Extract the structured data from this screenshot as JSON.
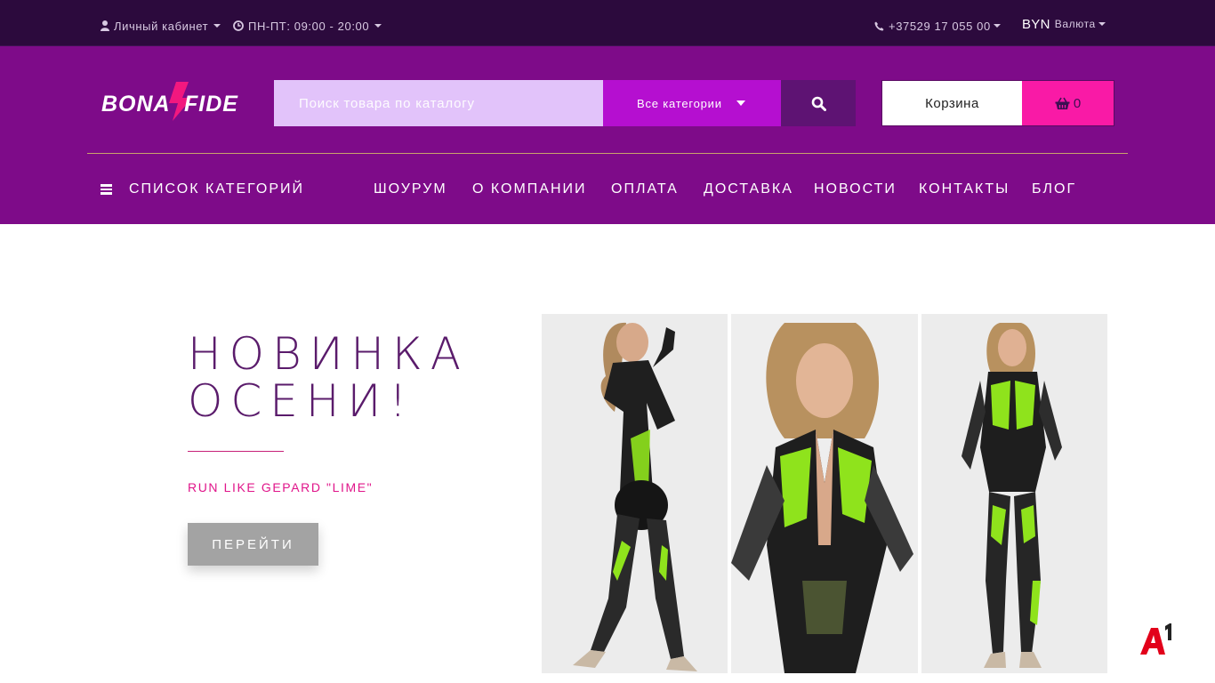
{
  "topbar": {
    "account_label": "Личный кабинет",
    "hours_label": "ПН-ПТ: 09:00 - 20:00",
    "phone_label": "+37529 17 055 00",
    "currency_code": "BYN",
    "currency_label": "Валюта"
  },
  "header": {
    "logo_text": "BONA FIDE",
    "search_placeholder": "Поиск товара по каталогу",
    "category_select": "Все категории",
    "cart_label": "Корзина",
    "cart_count": "0"
  },
  "nav": {
    "catalog_label": "Список категорий",
    "items": [
      "Шоурум",
      "О компании",
      "Оплата",
      "Доставка",
      "Новости",
      "Контакты",
      "Блог"
    ]
  },
  "hero": {
    "title_line1": "НОВИНКА",
    "title_line2": "ОСЕНИ!",
    "subtitle": "RUN LIKE GEPARD \"LIME\"",
    "button_label": "Перейти"
  },
  "widget": {
    "logo_text": "A1"
  },
  "colors": {
    "topbar_bg": "#2c0a3d",
    "header_bg": "#7e0b89",
    "search_bg": "#e2c3fa",
    "category_bg": "#b50fd0",
    "search_btn_bg": "#5e1373",
    "cart_accent": "#f91aa6",
    "hero_title": "#5a1b6b",
    "hero_subtitle": "#e0158a",
    "product_accent": "#8fe31c"
  }
}
